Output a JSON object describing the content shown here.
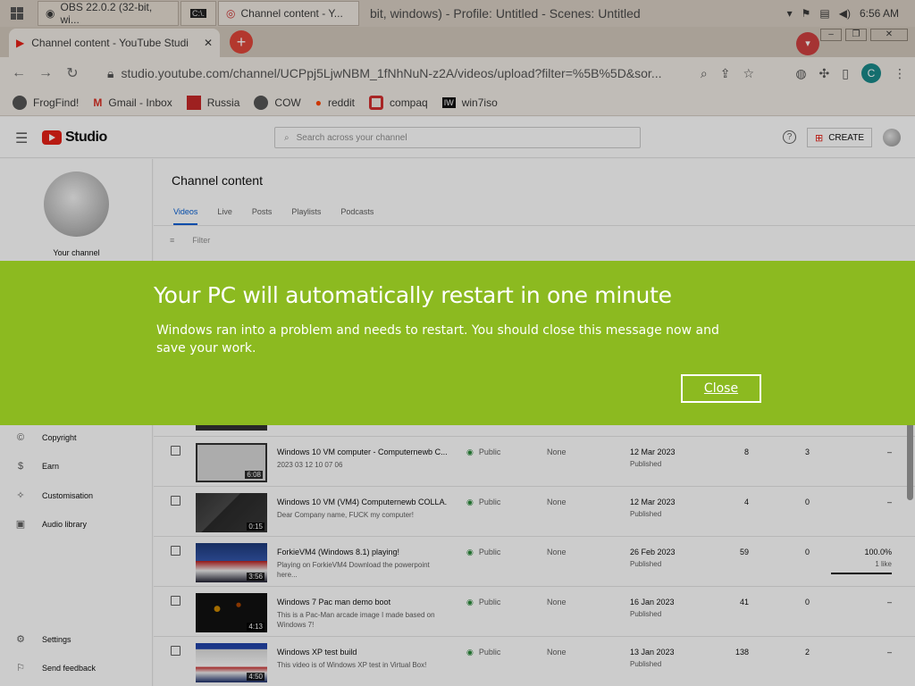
{
  "taskbar": {
    "tasks": [
      {
        "label": "OBS 22.0.2 (32-bit, wi..."
      },
      {
        "label": "C:\\."
      },
      {
        "label": "Channel content - Y..."
      }
    ],
    "window_title": "bit, windows) - Profile: Untitled - Scenes: Untitled",
    "clock": "6:56 AM"
  },
  "browser": {
    "tab_title": "Channel content - YouTube Studi",
    "url": "studio.youtube.com/channel/UCPpj5LjwNBM_1fNhNuN-z2A/videos/upload?filter=%5B%5D&sor...",
    "profile_initial": "C",
    "bookmarks": [
      {
        "label": "FrogFind!"
      },
      {
        "label": "Gmail - Inbox"
      },
      {
        "label": "Russia"
      },
      {
        "label": "COW"
      },
      {
        "label": "reddit"
      },
      {
        "label": "compaq"
      },
      {
        "label": "win7iso"
      }
    ]
  },
  "studio": {
    "logo_text": "Studio",
    "search_placeholder": "Search across your channel",
    "create_label": "CREATE",
    "your_channel": "Your channel",
    "sidebar": [
      {
        "label": "Copyright",
        "icon": "copyright-icon"
      },
      {
        "label": "Earn",
        "icon": "dollar-icon"
      },
      {
        "label": "Customisation",
        "icon": "wand-icon"
      },
      {
        "label": "Audio library",
        "icon": "audio-library-icon"
      },
      {
        "label": "Settings",
        "icon": "gear-icon"
      },
      {
        "label": "Send feedback",
        "icon": "feedback-icon"
      }
    ],
    "page_title": "Channel content",
    "tabs": [
      "Videos",
      "Live",
      "Posts",
      "Playlists",
      "Podcasts"
    ],
    "filter_label": "Filter",
    "videos": [
      {
        "title": "Windows 10 VM computer - Computernewb C...",
        "desc": "2023 03 12 10 07 06",
        "duration": "6:08",
        "visibility": "Public",
        "restrictions": "None",
        "date": "12 Mar 2023",
        "status": "Published",
        "views": "8",
        "comments": "3",
        "likes": "–",
        "likes_sub": ""
      },
      {
        "title": "Windows 10 VM (VM4) Computernewb COLLA...",
        "desc": "Dear Company name, FUCK my computer!",
        "duration": "0:15",
        "visibility": "Public",
        "restrictions": "None",
        "date": "12 Mar 2023",
        "status": "Published",
        "views": "4",
        "comments": "0",
        "likes": "–",
        "likes_sub": ""
      },
      {
        "title": "ForkieVM4 (Windows 8.1) playing!",
        "desc": "Playing on ForkieVM4 Download the powerpoint here...",
        "duration": "3:56",
        "visibility": "Public",
        "restrictions": "None",
        "date": "26 Feb 2023",
        "status": "Published",
        "views": "59",
        "comments": "0",
        "likes": "100.0%",
        "likes_sub": "1 like"
      },
      {
        "title": "Windows 7 Pac man demo boot",
        "desc": "This is a Pac-Man arcade image I made based on Windows 7!",
        "duration": "4:13",
        "visibility": "Public",
        "restrictions": "None",
        "date": "16 Jan 2023",
        "status": "Published",
        "views": "41",
        "comments": "0",
        "likes": "–",
        "likes_sub": ""
      },
      {
        "title": "Windows XP test build",
        "desc": "This video is of Windows XP test in Virtual Box!",
        "duration": "4:50",
        "visibility": "Public",
        "restrictions": "None",
        "date": "13 Jan 2023",
        "status": "Published",
        "views": "138",
        "comments": "2",
        "likes": "–",
        "likes_sub": ""
      }
    ]
  },
  "restart_dialog": {
    "title": "Your PC will automatically restart in one minute",
    "message": "Windows ran into a problem and needs to restart. You should close this message now and save your work.",
    "close_label": "Close",
    "background": "#8cba20"
  }
}
